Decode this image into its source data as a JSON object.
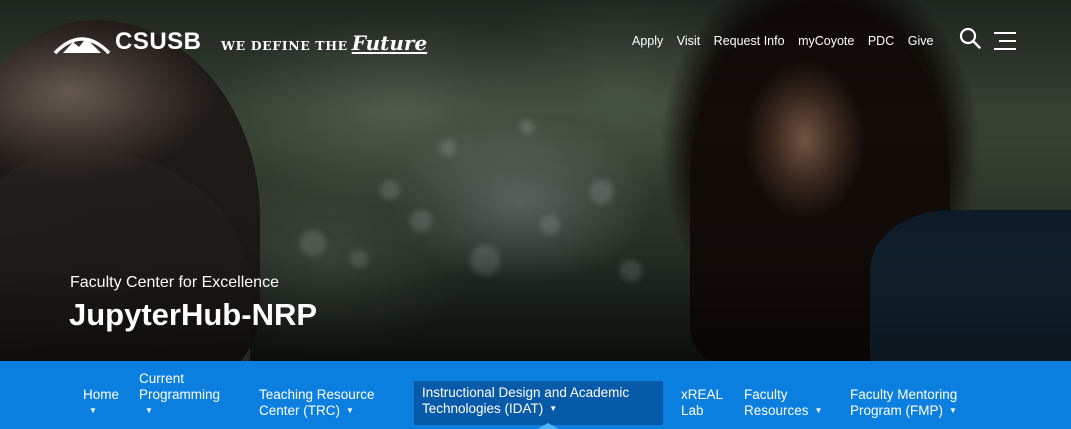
{
  "header": {
    "logo_text": "CSUSB",
    "tagline_main": "WE DEFINE THE",
    "tagline_script": "Future",
    "top_links": [
      "Apply",
      "Visit",
      "Request Info",
      "myCoyote",
      "PDC",
      "Give"
    ]
  },
  "hero": {
    "subtitle": "Faculty Center for Excellence",
    "title": "JupyterHub-NRP"
  },
  "subnav": {
    "items": [
      {
        "line1": "Home",
        "line2": ""
      },
      {
        "line1": "Current",
        "line2": "Programming"
      },
      {
        "line1": "Teaching Resource",
        "line2": "Center (TRC)"
      },
      {
        "line1": "Instructional Design and Academic",
        "line2": "Technologies (IDAT)"
      },
      {
        "line1": "xREAL",
        "line2": "Lab"
      },
      {
        "line1": "Faculty",
        "line2": "Resources"
      },
      {
        "line1": "Faculty Mentoring",
        "line2": "Program (FMP)"
      }
    ]
  },
  "icons": {
    "search": "search-icon",
    "menu": "hamburger-menu-icon",
    "caret": "caret-down-icon"
  },
  "colors": {
    "subnav_bg": "#0a7fe0",
    "active_bg": "#075aa8"
  }
}
